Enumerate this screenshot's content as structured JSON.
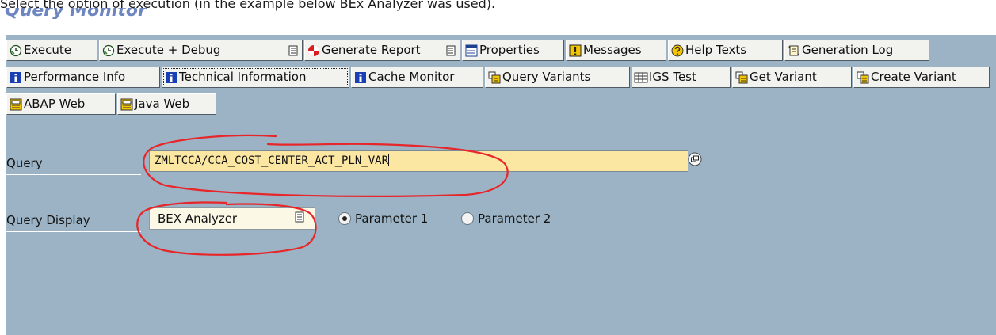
{
  "document": {
    "intro_text": "Select the option of execution (in the example below BEx Analyzer was used).",
    "heading": "Query Monitor"
  },
  "toolbar": {
    "row1": [
      {
        "label": "Execute",
        "icon": "execute-clock-icon"
      },
      {
        "label": "Execute + Debug",
        "icon": "execute-debug-clock-icon"
      },
      {
        "label": "Generate Report",
        "icon": "generate-report-icon"
      },
      {
        "label": "Properties",
        "icon": "properties-icon"
      },
      {
        "label": "Messages",
        "icon": "messages-icon"
      },
      {
        "label": "Help Texts",
        "icon": "help-texts-icon"
      },
      {
        "label": "Generation Log",
        "icon": "generation-log-icon"
      }
    ],
    "row2": [
      {
        "label": "Performance Info",
        "icon": "info-icon"
      },
      {
        "label": "Technical Information",
        "icon": "info-icon"
      },
      {
        "label": "Cache Monitor",
        "icon": "info-icon"
      },
      {
        "label": "Query Variants",
        "icon": "variants-icon"
      },
      {
        "label": "IGS Test",
        "icon": "igs-test-icon"
      },
      {
        "label": "Get Variant",
        "icon": "variants-icon"
      },
      {
        "label": "Create Variant",
        "icon": "variants-icon"
      }
    ],
    "row3": [
      {
        "label": "ABAP Web",
        "icon": "web-document-icon"
      },
      {
        "label": "Java Web",
        "icon": "web-document-icon"
      }
    ]
  },
  "form": {
    "query_label": "Query",
    "query_value": "ZMLTCCA/CCA_COST_CENTER_ACT_PLN_VAR",
    "query_display_label": "Query Display",
    "query_display_value": "BEX Analyzer",
    "radio_options": [
      {
        "label": "Parameter 1",
        "checked": true
      },
      {
        "label": "Parameter 2",
        "checked": false
      }
    ]
  },
  "colors": {
    "window_background": "#9bb3c4",
    "input_highlight": "#fbe6a2",
    "annotation_red": "#e8262a"
  }
}
